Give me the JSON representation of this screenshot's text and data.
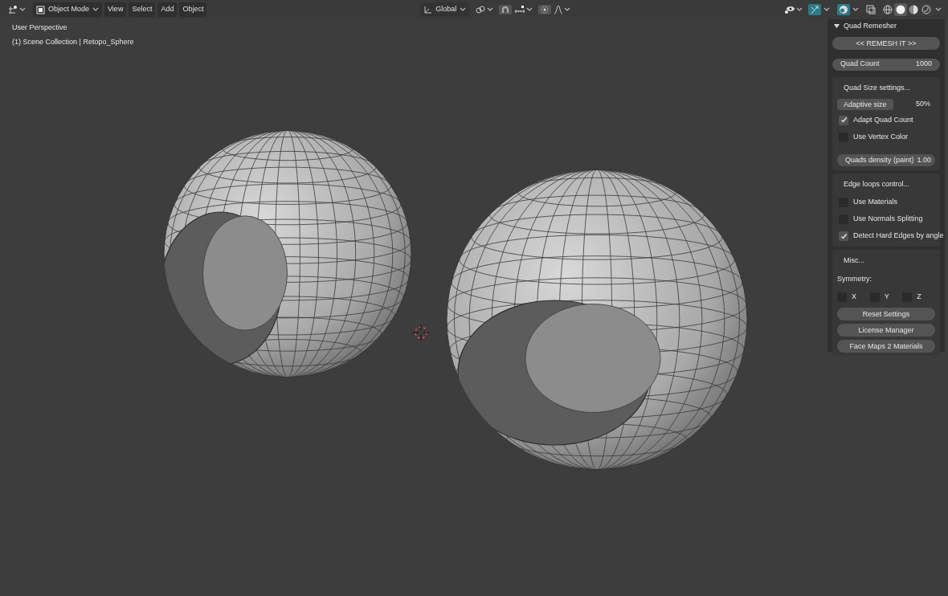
{
  "header": {
    "mode": "Object Mode",
    "menus": [
      "View",
      "Select",
      "Add",
      "Object"
    ],
    "orientation": "Global",
    "shading_modes": [
      {
        "kind": "wireframe",
        "selected": false
      },
      {
        "kind": "solid",
        "selected": true
      },
      {
        "kind": "material",
        "selected": false
      },
      {
        "kind": "rendered",
        "selected": false
      }
    ]
  },
  "viewport": {
    "view_name": "User Perspective",
    "collection": "(1) Scene Collection | Retopo_Sphere"
  },
  "panel": {
    "title": "Quad Remesher",
    "expanded": true,
    "top_items": [
      {
        "kind": "button",
        "label": "<< REMESH IT >>"
      },
      {
        "kind": "field",
        "label": "Quad Count",
        "value": "1000"
      }
    ],
    "boxes": [
      {
        "items": [
          {
            "kind": "heading",
            "label": "Quad Size settings..."
          },
          {
            "kind": "pair",
            "label": "Adaptive size",
            "value": "50%"
          },
          {
            "kind": "checkbox",
            "label": "Adapt Quad Count",
            "checked": true
          },
          {
            "kind": "checkbox",
            "label": "Use Vertex Color",
            "checked": false
          },
          {
            "kind": "spacer"
          },
          {
            "kind": "field",
            "label": "Quads density (paint)",
            "value": "1.00"
          }
        ]
      },
      {
        "items": [
          {
            "kind": "heading",
            "label": "Edge loops control..."
          },
          {
            "kind": "checkbox",
            "label": "Use Materials",
            "checked": false
          },
          {
            "kind": "checkbox",
            "label": "Use Normals Splitting",
            "checked": false
          },
          {
            "kind": "checkbox",
            "label": "Detect Hard Edges by angle",
            "checked": true
          }
        ]
      },
      {
        "items": [
          {
            "kind": "heading",
            "label": "Misc..."
          },
          {
            "kind": "label",
            "label": "Symmetry:"
          },
          {
            "kind": "axes",
            "axes": [
              {
                "label": "X",
                "checked": false
              },
              {
                "label": "Y",
                "checked": false
              },
              {
                "label": "Z",
                "checked": false
              }
            ]
          },
          {
            "kind": "button",
            "label": "Reset Settings"
          },
          {
            "kind": "button",
            "label": "License Manager"
          },
          {
            "kind": "button",
            "label": "Face Maps 2 Materials"
          }
        ]
      }
    ]
  }
}
